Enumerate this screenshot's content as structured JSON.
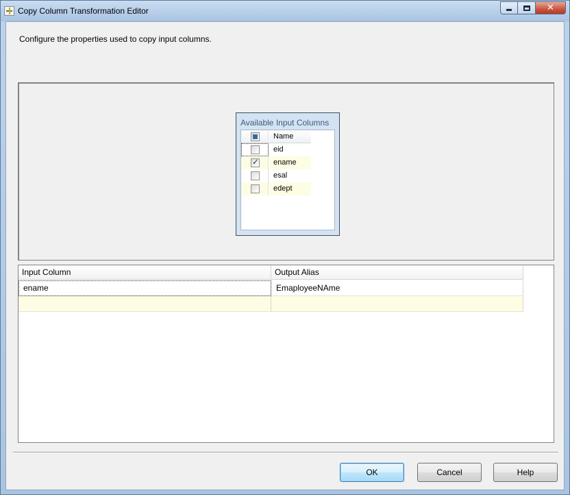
{
  "window": {
    "title": "Copy Column Transformation Editor",
    "close_glyph": "✕"
  },
  "header": {
    "description": "Configure the properties used to copy input columns."
  },
  "available_columns": {
    "title": "Available Input Columns",
    "header_label": "Name",
    "header_checkbox_state": "indeterminate",
    "rows": [
      {
        "name": "eid",
        "checked": false
      },
      {
        "name": "ename",
        "checked": true
      },
      {
        "name": "esal",
        "checked": false
      },
      {
        "name": "edept",
        "checked": false
      }
    ]
  },
  "mapping_grid": {
    "columns": [
      "Input Column",
      "Output Alias"
    ],
    "rows": [
      {
        "input_column": "ename",
        "output_alias": "EmaployeeNAme"
      }
    ]
  },
  "buttons": {
    "ok": "OK",
    "cancel": "Cancel",
    "help": "Help"
  },
  "colors": {
    "alt_row": "#fdfde3",
    "title_accent": "#3d5a84",
    "close_button": "#c8563f"
  }
}
